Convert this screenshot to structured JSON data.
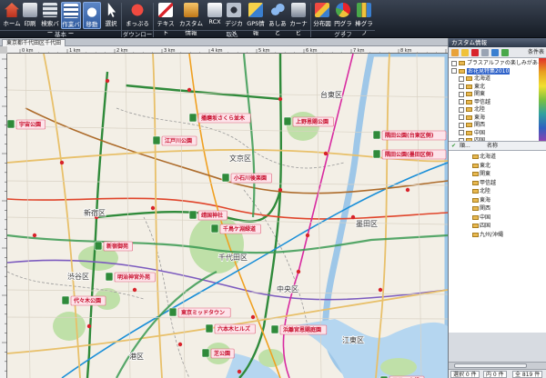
{
  "ribbon": {
    "buttons": [
      {
        "label": "ホーム",
        "icon": "home-icon",
        "color": "#d84a32"
      },
      {
        "label": "印刷",
        "icon": "print-icon",
        "color": "#9aa4b4"
      },
      {
        "label": "検索バー",
        "icon": "search-bar-icon",
        "color": "#b8c0cc"
      },
      {
        "label": "作業バー",
        "icon": "work-bar-icon",
        "color": "#ffffff"
      },
      {
        "label": "移動",
        "icon": "pointer-hand-icon",
        "color": "#ffffff"
      },
      {
        "label": "選択",
        "icon": "cursor-icon",
        "color": "#ffffff"
      },
      {
        "label": "まっぷる",
        "icon": "mapple-icon",
        "color": "#d8232a"
      },
      {
        "label": "テキスト",
        "icon": "text-icon",
        "color": "#ffffff"
      },
      {
        "label": "カスタム情報",
        "icon": "custom-info-icon",
        "color": "#e8a23a"
      },
      {
        "label": "RCX",
        "icon": "rcx-icon",
        "color": "#f0f0f0"
      },
      {
        "label": "デジカメ",
        "icon": "camera-icon",
        "color": "#9aa4b4"
      },
      {
        "label": "GPS情報",
        "icon": "gps-icon",
        "color": "#f0c23a"
      },
      {
        "label": "あしあと",
        "icon": "footprint-icon",
        "color": "#6fa0e0"
      },
      {
        "label": "カーナビ",
        "icon": "car-navi-icon",
        "color": "#d0d4da"
      },
      {
        "label": "分布図",
        "icon": "distribution-icon",
        "color": "#d8232a"
      },
      {
        "label": "円グラフ",
        "icon": "pie-chart-icon",
        "color": "#e8a23a"
      },
      {
        "label": "棒グラフ",
        "icon": "bar-chart-icon",
        "color": "#4aa84a"
      }
    ],
    "groups": [
      "基本",
      "ダウンロード",
      "取込",
      "グラフ"
    ]
  },
  "map": {
    "tab_label": "東京都千代田区千代田",
    "ruler_marks": [
      "0 km",
      "1 km",
      "2 km",
      "3 km",
      "4 km",
      "5 km",
      "6 km",
      "7 km",
      "8 km",
      "9 km"
    ],
    "wards": [
      "台東区",
      "文京区",
      "新宿区",
      "千代田区",
      "墨田区",
      "渋谷区",
      "中央区",
      "港区",
      "江東区"
    ],
    "pois": [
      "江戸川公園",
      "播磨坂さくら並木",
      "上野恩賜公園",
      "隅田公園(台東区側)",
      "隅田公園(墨田区側)",
      "小石川後楽園",
      "靖国神社",
      "千鳥ケ淵緑道",
      "新宿御苑",
      "明治神宮外苑",
      "代々木公園",
      "六本木ヒルズ",
      "東京ミッドタウン",
      "浜離宮恩賜庭園",
      "芝公園",
      "辰巳の森緑",
      "宇宙公園"
    ]
  },
  "panel": {
    "title": "カスタム情報",
    "toolbar_condition": "条件表",
    "tree": [
      {
        "label": "プラスアルファの楽しみがある1",
        "selected": false
      },
      {
        "label": "お花見特集2010",
        "selected": true
      },
      {
        "label": "北海道",
        "selected": false
      },
      {
        "label": "東北",
        "selected": false
      },
      {
        "label": "関東",
        "selected": false
      },
      {
        "label": "甲信越",
        "selected": false
      },
      {
        "label": "北陸",
        "selected": false
      },
      {
        "label": "東海",
        "selected": false
      },
      {
        "label": "関西",
        "selected": false
      },
      {
        "label": "中国",
        "selected": false
      },
      {
        "label": "四国",
        "selected": false
      },
      {
        "label": "九州/沖縄",
        "selected": false
      }
    ],
    "list_header": {
      "check": "✔",
      "col1": "順...",
      "col2": "名称"
    },
    "list": [
      "北海道",
      "東北",
      "関東",
      "甲信越",
      "北陸",
      "東海",
      "関西",
      "中国",
      "四国",
      "九州/沖縄"
    ],
    "status": {
      "selected": "選択 0 件",
      "inner": "内 0 件",
      "total": "全 819 件"
    }
  }
}
